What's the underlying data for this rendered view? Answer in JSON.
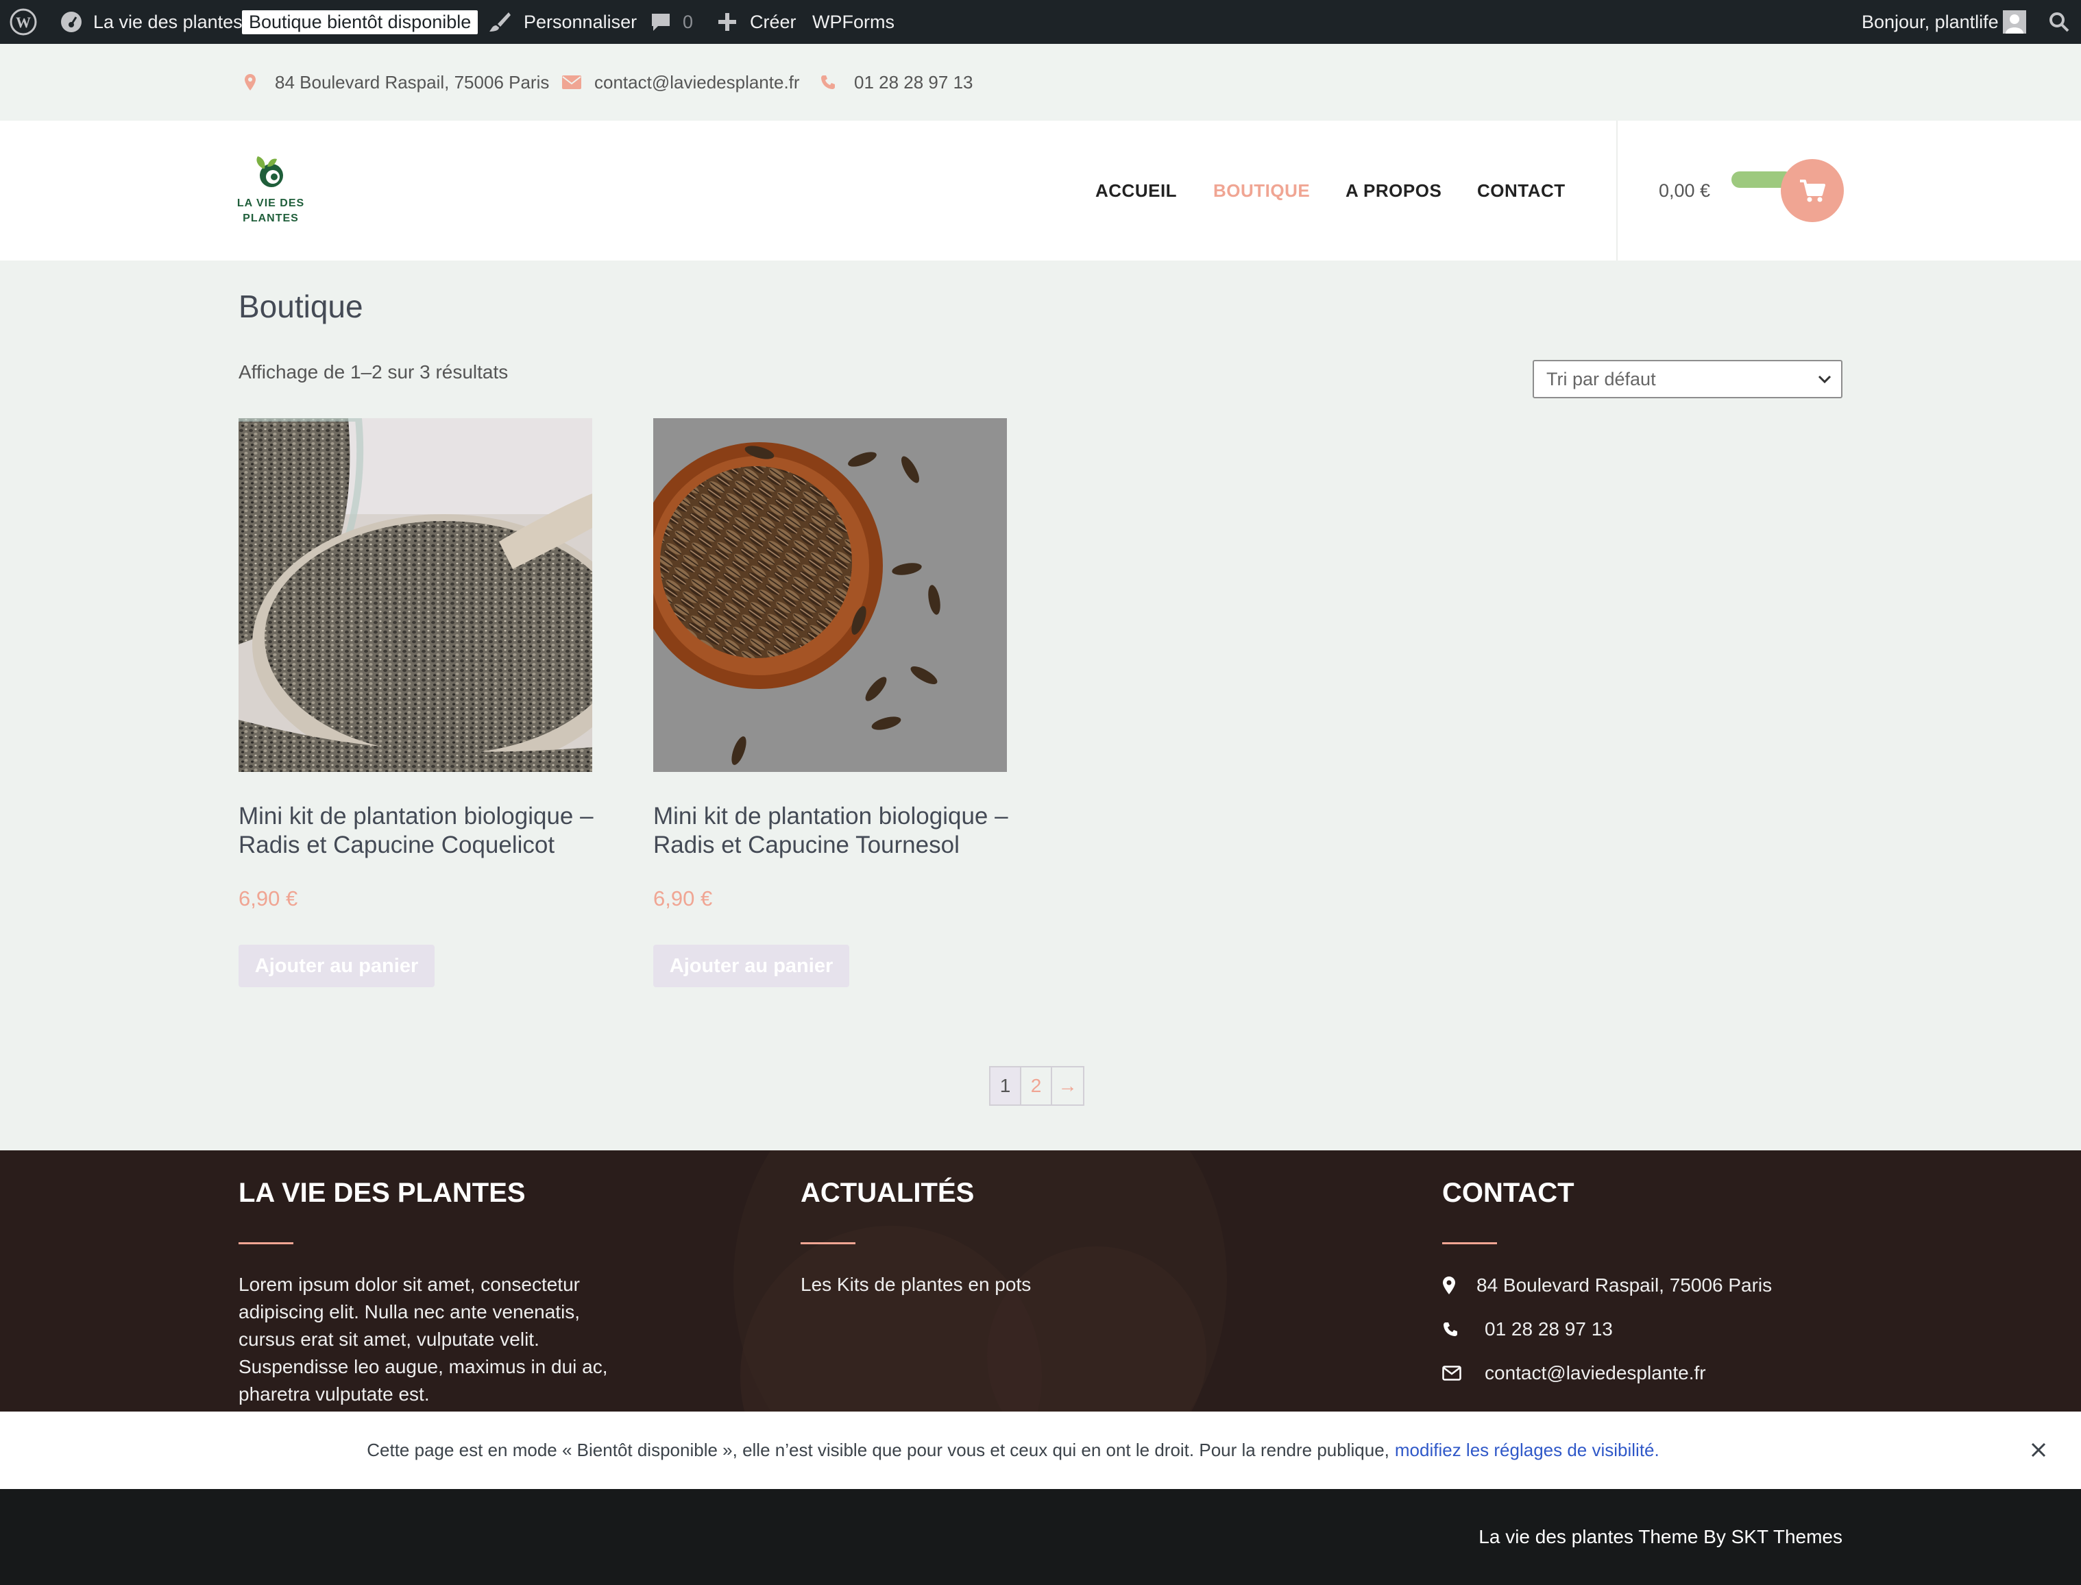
{
  "admin_bar": {
    "wp_logo_icon": "wordpress-icon",
    "site_name": "La vie des plantes",
    "mode_badge": "Boutique bientôt disponible",
    "customize": "Personnaliser",
    "comments_count": "0",
    "create": "Créer",
    "wpforms": "WPForms",
    "greeting": "Bonjour, plantlife"
  },
  "topbar": {
    "address": "84 Boulevard Raspail, 75006 Paris",
    "email": "contact@laviedesplante.fr",
    "phone": "01 28 28 97 13"
  },
  "header": {
    "logo_line1": "LA VIE DES",
    "logo_line2": "PLANTES",
    "nav": [
      "ACCUEIL",
      "BOUTIQUE",
      "A PROPOS",
      "CONTACT"
    ],
    "active_nav": "BOUTIQUE",
    "cart_total": "0,00 €"
  },
  "shop": {
    "title": "Boutique",
    "result_count": "Affichage de 1–2 sur 3 résultats",
    "sort_selected": "Tri par défaut",
    "products": [
      {
        "title": "Mini kit de plantation biologique – Radis et Capucine Coquelicot",
        "price": "6,90 €",
        "button": "Ajouter au panier"
      },
      {
        "title": "Mini kit de plantation biologique – Radis et Capucine Tournesol",
        "price": "6,90 €",
        "button": "Ajouter au panier"
      }
    ],
    "pagination": [
      "1",
      "2",
      "→"
    ],
    "current_page": "1"
  },
  "footer": {
    "col1_title": "LA VIE DES PLANTES",
    "col1_text": "Lorem ipsum dolor sit amet, consectetur adipiscing elit. Nulla nec ante venenatis, cursus erat sit amet, vulputate velit. Suspendisse leo augue, maximus in dui ac, pharetra vulputate est.",
    "col2_title": "ACTUALITÉS",
    "col2_link": "Les Kits de plantes en pots",
    "col3_title": "CONTACT",
    "address": "84 Boulevard Raspail, 75006 Paris",
    "phone": "01 28 28 97 13",
    "email": "contact@laviedesplante.fr"
  },
  "notice": {
    "message": "Cette page est en mode « Bientôt disponible », elle n’est visible que pour vous et ceux qui en ont le droit. Pour la rendre publique,",
    "link": "modifiez les réglages de visibilité."
  },
  "bottom": {
    "credit": "La vie des plantes Theme By SKT Themes"
  },
  "colors": {
    "accent": "#f0a593",
    "admin_bar": "#1d2327",
    "footer_bg": "#2a1d1b",
    "cart_green": "#9dc97e"
  }
}
